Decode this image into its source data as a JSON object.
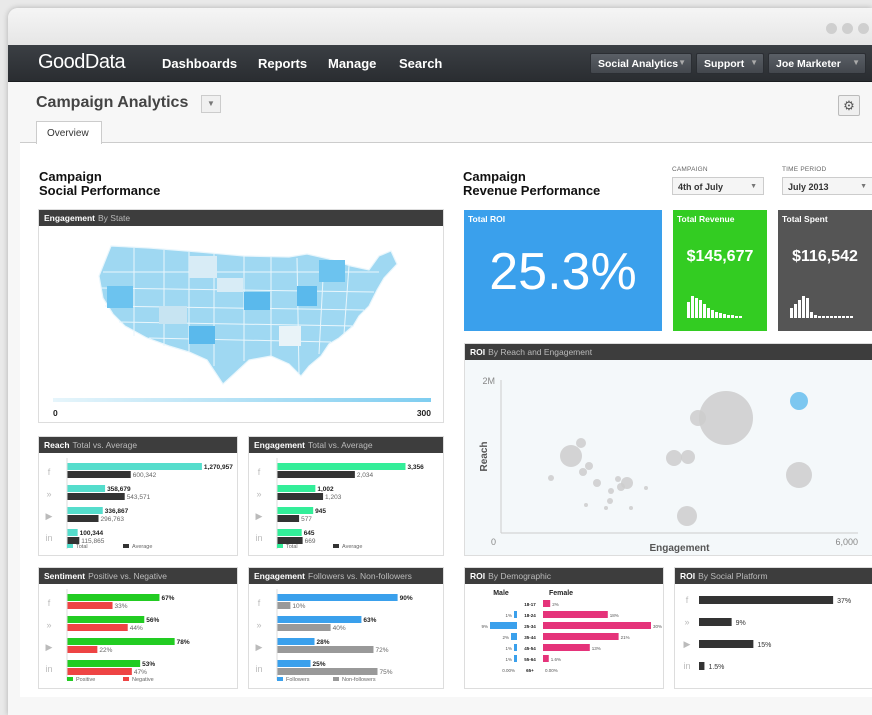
{
  "window": {
    "dots": [
      "#cfcfcf",
      "#cfcfcf",
      "#cfcfcf"
    ]
  },
  "navbar": {
    "logo": "GoodData",
    "links": [
      "Dashboards",
      "Reports",
      "Manage",
      "Search"
    ],
    "buttons": [
      {
        "label": "Social Analytics"
      },
      {
        "label": "Support"
      },
      {
        "label": "Joe Marketer"
      }
    ]
  },
  "page": {
    "title": "Campaign Analytics",
    "tab": "Overview"
  },
  "social": {
    "heading_line1": "Campaign",
    "heading_line2": "Social Performance",
    "map": {
      "title": "Engagement",
      "subtitle": "By State",
      "scale_min": "0",
      "scale_max": "300"
    }
  },
  "revenue": {
    "heading_line1": "Campaign",
    "heading_line2": "Revenue Performance",
    "filters": {
      "campaign_label": "CAMPAIGN",
      "campaign_value": "4th of July",
      "period_label": "TIME PERIOD",
      "period_value": "July 2013"
    },
    "kpis": {
      "roi_label": "Total ROI",
      "roi_value": "25.3%",
      "revenue_label": "Total Revenue",
      "revenue_value": "$145,677",
      "spent_label": "Total Spent",
      "spent_value": "$116,542"
    }
  },
  "colors": {
    "roi_blue": "#3aa0ec",
    "revenue_green": "#33cc22",
    "spent_gray": "#555555",
    "teal": "#55ddcc",
    "pink": "#e5337a",
    "bar_green": "#22cc22",
    "bar_red": "#ee4444",
    "bar_blue": "#3aa0ec"
  },
  "chart_data": [
    {
      "type": "bar",
      "id": "reach",
      "title": "Reach",
      "subtitle": "Total vs. Average",
      "categories": [
        "facebook",
        "twitter",
        "youtube",
        "linkedin"
      ],
      "icons": [
        "f",
        "»",
        "▶",
        "in"
      ],
      "series": [
        {
          "name": "Total",
          "values": [
            1270957,
            358679,
            336867,
            100344
          ],
          "labels": [
            "1,270,957",
            "358,679",
            "336,867",
            "100,344"
          ]
        },
        {
          "name": "Average",
          "values": [
            600342,
            543571,
            296763,
            115865
          ],
          "labels": [
            "600,342",
            "543,571",
            "296,763",
            "115,865"
          ]
        }
      ],
      "xlim": [
        0,
        1300000
      ]
    },
    {
      "type": "bar",
      "id": "engagement",
      "title": "Engagement",
      "subtitle": "Total vs. Average",
      "categories": [
        "facebook",
        "twitter",
        "youtube",
        "linkedin"
      ],
      "icons": [
        "f",
        "»",
        "▶",
        "in"
      ],
      "series": [
        {
          "name": "Total",
          "values": [
            3356,
            1002,
            945,
            645
          ],
          "labels": [
            "3,356",
            "1,002",
            "945",
            "645"
          ]
        },
        {
          "name": "Average",
          "values": [
            2034,
            1203,
            577,
            669
          ],
          "labels": [
            "2,034",
            "1,203",
            "577",
            "669"
          ]
        }
      ],
      "xlim": [
        0,
        3500
      ]
    },
    {
      "type": "bar",
      "id": "sentiment",
      "title": "Sentiment",
      "subtitle": "Positive vs. Negative",
      "categories": [
        "facebook",
        "twitter",
        "youtube",
        "linkedin"
      ],
      "icons": [
        "f",
        "»",
        "▶",
        "in"
      ],
      "series": [
        {
          "name": "Positive",
          "values": [
            67,
            56,
            78,
            53
          ],
          "labels": [
            "67%",
            "56%",
            "78%",
            "53%"
          ]
        },
        {
          "name": "Negative",
          "values": [
            33,
            44,
            22,
            47
          ],
          "labels": [
            "33%",
            "44%",
            "22%",
            "47%"
          ]
        }
      ],
      "xlim": [
        0,
        100
      ]
    },
    {
      "type": "bar",
      "id": "followers",
      "title": "Engagement",
      "subtitle": "Followers vs. Non-followers",
      "categories": [
        "facebook",
        "twitter",
        "youtube",
        "linkedin"
      ],
      "icons": [
        "f",
        "»",
        "▶",
        "in"
      ],
      "series": [
        {
          "name": "Followers",
          "values": [
            90,
            63,
            28,
            25
          ],
          "labels": [
            "90%",
            "63%",
            "28%",
            "25%"
          ]
        },
        {
          "name": "Non-followers",
          "values": [
            10,
            40,
            72,
            75
          ],
          "labels": [
            "10%",
            "40%",
            "72%",
            "75%"
          ]
        }
      ],
      "xlim": [
        0,
        100
      ]
    },
    {
      "type": "scatter",
      "id": "roi_reach",
      "title": "ROI",
      "subtitle": "By Reach and Engagement",
      "xlabel": "Engagement",
      "ylabel": "Reach",
      "xlim": [
        0,
        6000
      ],
      "ylim": [
        0,
        2000000
      ],
      "x_ticks": [
        "0",
        "6,000"
      ],
      "y_ticks": [
        "2M"
      ]
    },
    {
      "type": "bar",
      "id": "roi_demo",
      "title": "ROI",
      "subtitle": "By Demographic",
      "series_names": [
        "Male",
        "Female"
      ],
      "categories": [
        "18-17",
        "18-24",
        "25-34",
        "35-44",
        "45-54",
        "55-64",
        "65+"
      ],
      "male_labels": [
        "",
        "1%",
        "9%",
        "2%",
        "1%",
        "1%",
        "0.00%"
      ],
      "female_labels": [
        "2%",
        "18%",
        "30%",
        "21%",
        "13%",
        "1.6%",
        "0.00%"
      ],
      "male": [
        0,
        1,
        9,
        2,
        1,
        1,
        0
      ],
      "female": [
        2,
        18,
        30,
        21,
        13,
        1.6,
        0
      ]
    },
    {
      "type": "bar",
      "id": "roi_platform",
      "title": "ROI",
      "subtitle": "By Social Platform",
      "categories": [
        "facebook",
        "twitter",
        "youtube",
        "linkedin"
      ],
      "icons": [
        "f",
        "»",
        "▶",
        "in"
      ],
      "values": [
        37,
        9,
        15,
        1.5
      ],
      "labels": [
        "37%",
        "9%",
        "15%",
        "1.5%"
      ],
      "xlim": [
        0,
        40
      ]
    }
  ]
}
